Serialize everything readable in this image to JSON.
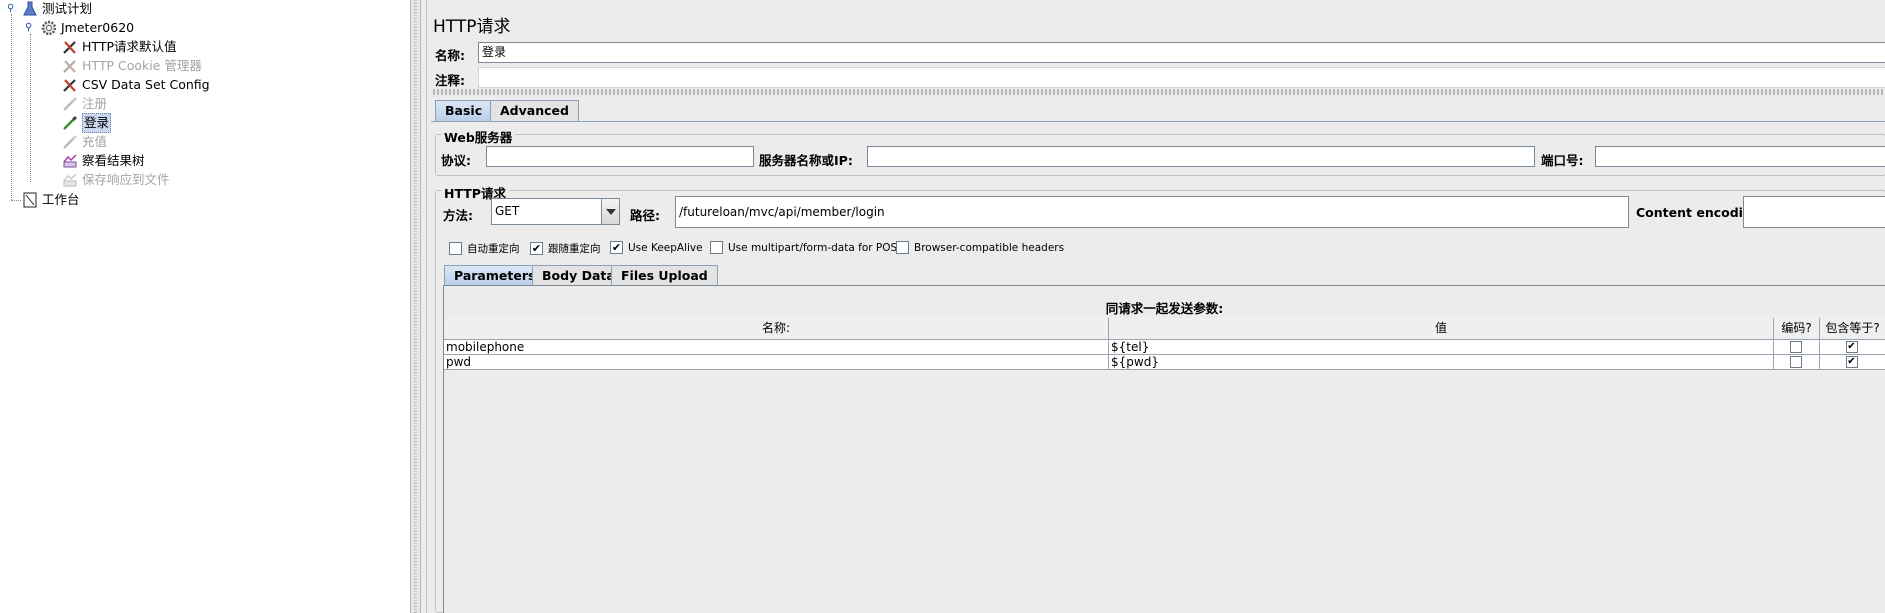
{
  "tree": {
    "items": [
      {
        "label": "测试计划",
        "icon": "test-plan-icon",
        "disabled": false,
        "selected": false
      },
      {
        "label": "Jmeter0620",
        "icon": "thread-group-gear-icon",
        "disabled": false,
        "selected": false
      },
      {
        "label": "HTTP请求默认值",
        "icon": "config-tools-icon",
        "disabled": false,
        "selected": false
      },
      {
        "label": "HTTP Cookie 管理器",
        "icon": "config-tools-icon",
        "disabled": true,
        "selected": false
      },
      {
        "label": "CSV Data Set Config",
        "icon": "config-tools-icon",
        "disabled": false,
        "selected": false
      },
      {
        "label": "注册",
        "icon": "sampler-pipette-icon",
        "disabled": true,
        "selected": false
      },
      {
        "label": "登录",
        "icon": "sampler-pipette-icon",
        "disabled": false,
        "selected": true
      },
      {
        "label": "充值",
        "icon": "sampler-pipette-icon",
        "disabled": true,
        "selected": false
      },
      {
        "label": "察看结果树",
        "icon": "listener-chart-icon",
        "disabled": false,
        "selected": false
      },
      {
        "label": "保存响应到文件",
        "icon": "listener-chart-icon",
        "disabled": true,
        "selected": false
      },
      {
        "label": "工作台",
        "icon": "workbench-icon",
        "disabled": false,
        "selected": false
      }
    ]
  },
  "panel": {
    "title": "HTTP请求",
    "name_label": "名称:",
    "name_value": "登录",
    "comment_label": "注释:",
    "comment_value": "",
    "tabs": {
      "basic": "Basic",
      "advanced": "Advanced"
    },
    "web_server": {
      "title": "Web服务器",
      "protocol_label": "协议:",
      "protocol_value": "",
      "server_label": "服务器名称或IP:",
      "server_value": "",
      "port_label": "端口号:",
      "port_value": ""
    },
    "http_request": {
      "title": "HTTP请求",
      "method_label": "方法:",
      "method_value": "GET",
      "path_label": "路径:",
      "path_value": "/futureloan/mvc/api/member/login",
      "encoding_label": "Content encoding:",
      "encoding_value": ""
    },
    "options": [
      {
        "label": "自动重定向",
        "checked": false
      },
      {
        "label": "跟随重定向",
        "checked": true
      },
      {
        "label": "Use KeepAlive",
        "checked": true
      },
      {
        "label": "Use multipart/form-data for POST",
        "checked": false
      },
      {
        "label": "Browser-compatible headers",
        "checked": false
      }
    ],
    "sub_tabs": {
      "parameters": "Parameters",
      "body_data": "Body Data",
      "files_upload": "Files Upload"
    },
    "params_table": {
      "caption": "同请求一起发送参数:",
      "headers": [
        "名称:",
        "值",
        "编码?",
        "包含等于?"
      ],
      "rows": [
        {
          "name": "mobilephone",
          "value": "${tel}",
          "encode": false,
          "include_equals": true
        },
        {
          "name": "pwd",
          "value": "${pwd}",
          "encode": false,
          "include_equals": true
        }
      ]
    }
  },
  "colors": {
    "selection": "#c9d7ef",
    "tab_active": "#b8cfe9",
    "disabled_text": "#a4a4a4"
  }
}
